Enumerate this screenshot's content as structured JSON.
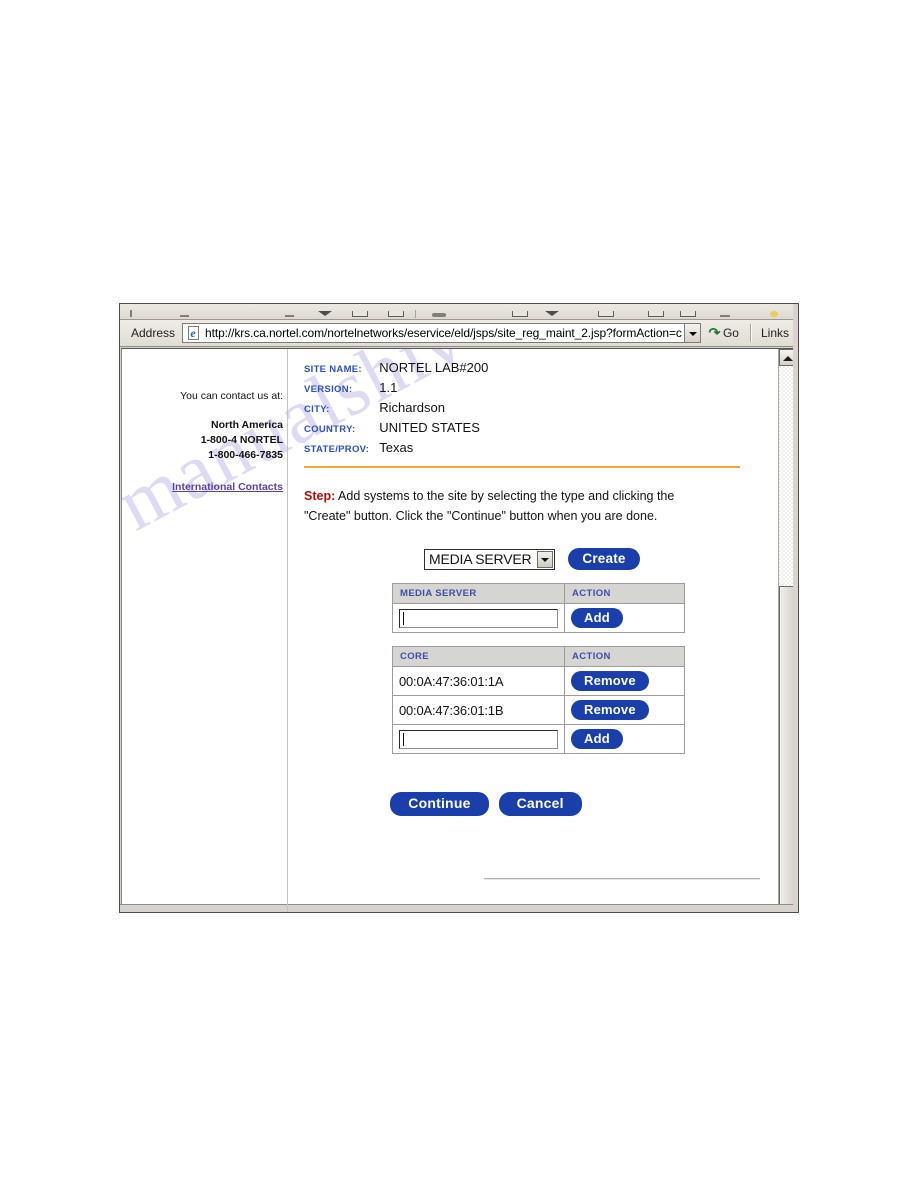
{
  "browser": {
    "address_label": "Address",
    "url": "http://krs.ca.nortel.com/nortelnetworks/eservice/eld/jsps/site_reg_maint_2.jsp?formAction=c",
    "go_label": "Go",
    "links_label": "Links",
    "ie_icon_letter": "e"
  },
  "watermark": "manualshive.com",
  "sidebar": {
    "contact_lead": "You can contact us at:",
    "region": "North America",
    "phone1": "1-800-4 NORTEL",
    "phone2": "1-800-466-7835",
    "international_link": "International Contacts"
  },
  "site_info": {
    "rows": [
      {
        "key": "SITE NAME:",
        "value": "NORTEL LAB#200"
      },
      {
        "key": "VERSION:",
        "value": "1.1"
      },
      {
        "key": "CITY:",
        "value": "Richardson"
      },
      {
        "key": "COUNTRY:",
        "value": "UNITED STATES"
      },
      {
        "key": "STATE/PROV:",
        "value": "Texas"
      }
    ]
  },
  "step": {
    "label": "Step:",
    "text_line1": " Add systems to the site by selecting the type and clicking the",
    "text_line2": "\"Create\" button. Click the \"Continue\" button when you are done."
  },
  "create_row": {
    "selected_type": "MEDIA SERVER",
    "create_label": "Create"
  },
  "tables": [
    {
      "header_type": "MEDIA SERVER",
      "header_action": "ACTION",
      "rows": [
        {
          "kind": "input",
          "value": "",
          "action_label": "Add"
        }
      ]
    },
    {
      "header_type": "CORE",
      "header_action": "ACTION",
      "rows": [
        {
          "kind": "value",
          "value": "00:0A:47:36:01:1A",
          "action_label": "Remove"
        },
        {
          "kind": "value",
          "value": "00:0A:47:36:01:1B",
          "action_label": "Remove"
        },
        {
          "kind": "input",
          "value": "",
          "action_label": "Add"
        }
      ]
    }
  ],
  "bottom_actions": {
    "continue_label": "Continue",
    "cancel_label": "Cancel"
  },
  "colors": {
    "button_blue": "#1a3faa",
    "key_blue": "#2b4ecb",
    "step_red": "#b00d0d",
    "rule_orange": "#e8a83c",
    "link_purple": "#5a3fa8",
    "watermark_purple": "#c9c6ee"
  }
}
